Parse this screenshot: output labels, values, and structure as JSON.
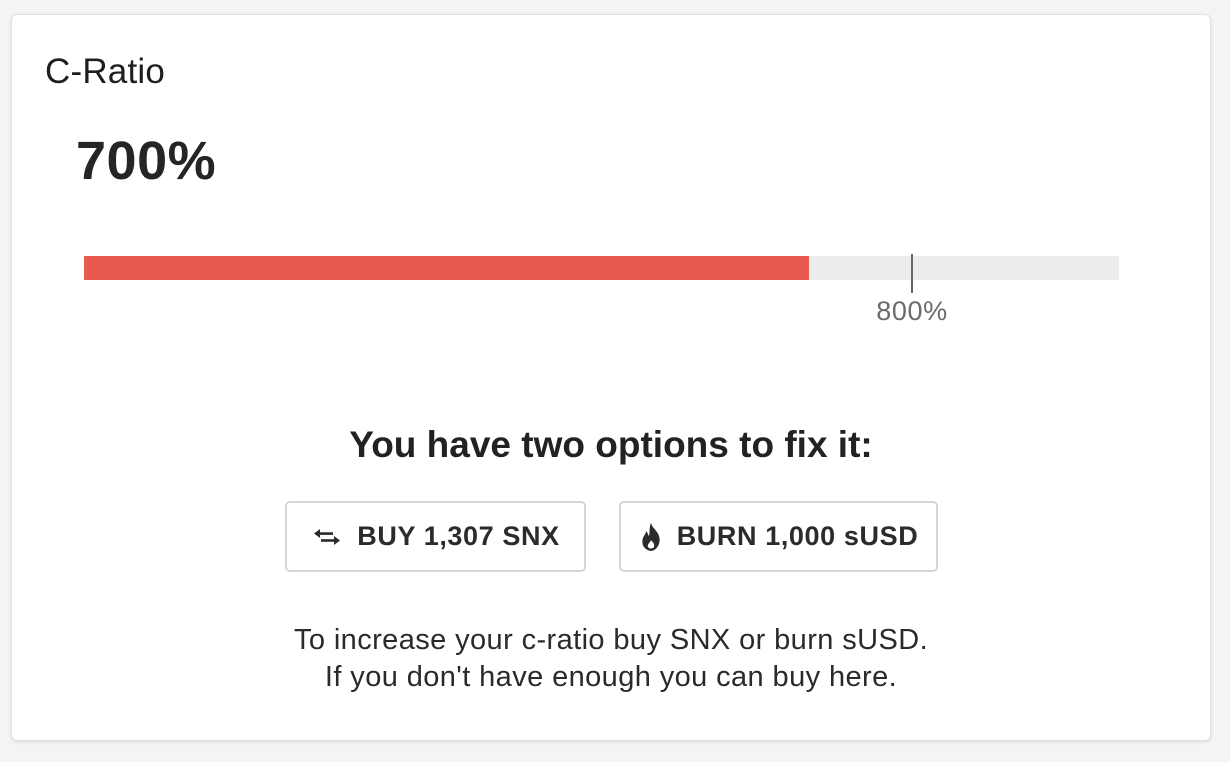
{
  "card": {
    "title": "C-Ratio"
  },
  "ratio": {
    "current_label": "700%",
    "current_fraction": 0.7,
    "target_label": "800%",
    "target_fraction": 0.8,
    "bar_color": "#e85a4f",
    "track_color": "#ececec"
  },
  "options": {
    "heading": "You have two options to fix it:",
    "buy_button": {
      "label": "BUY 1,307 SNX",
      "icon": "swap-arrows-icon"
    },
    "burn_button": {
      "label": "BURN 1,000 sUSD",
      "icon": "flame-icon"
    }
  },
  "help": {
    "line1": "To increase your c-ratio buy SNX or burn sUSD.",
    "line2": "If you don't have enough you can buy here."
  }
}
